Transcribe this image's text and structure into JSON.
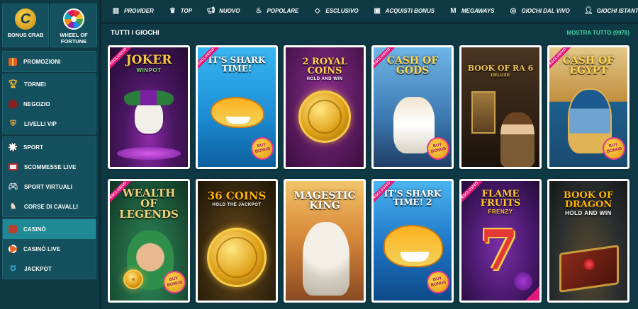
{
  "sidebar": {
    "tiles": [
      {
        "label": "Bonus Crab",
        "icon": "crab-coin-icon"
      },
      {
        "label": "Wheel of Fortune",
        "icon": "fortune-wheel-icon"
      }
    ],
    "group1": [
      {
        "label": "Promozioni",
        "icon": "gift-icon"
      }
    ],
    "group2": [
      {
        "label": "Tornei",
        "icon": "trophy-icon"
      },
      {
        "label": "Negozio",
        "icon": "shopping-bag-icon"
      },
      {
        "label": "Livelli VIP",
        "icon": "vip-shield-icon"
      }
    ],
    "group3": [
      {
        "label": "Sport",
        "icon": "soccer-ball-icon"
      },
      {
        "label": "Scommesse Live",
        "icon": "live-monitor-icon"
      },
      {
        "label": "Sport Virtuali",
        "icon": "gamepad-icon"
      },
      {
        "label": "Corse di Cavalli",
        "icon": "horse-icon"
      }
    ],
    "group4": [
      {
        "label": "Casinò",
        "icon": "casino-chip-icon",
        "active": true
      },
      {
        "label": "Casinò Live",
        "icon": "live-chip-icon"
      },
      {
        "label": "Jackpot",
        "icon": "horseshoe-icon"
      }
    ]
  },
  "topnav": [
    {
      "label": "Provider",
      "icon": "book-icon"
    },
    {
      "label": "Top",
      "icon": "crown-icon"
    },
    {
      "label": "Nuovo",
      "icon": "megaphone-icon"
    },
    {
      "label": "Popolare",
      "icon": "flame-icon"
    },
    {
      "label": "Esclusivo",
      "icon": "diamond-icon"
    },
    {
      "label": "Acquisti Bonus",
      "icon": "gift-box-icon"
    },
    {
      "label": "Megaways",
      "icon": "megaways-m-icon"
    },
    {
      "label": "Giochi dal vivo",
      "icon": "roulette-icon"
    },
    {
      "label": "Giochi istantanei",
      "icon": "person-icon"
    }
  ],
  "main": {
    "section_title": "Tutti i giochi",
    "show_all": "Mostra tutto (9978)"
  },
  "games": [
    {
      "title": "JOKER",
      "subtitle": "WINPOT",
      "exclusive": true,
      "buy_bonus": false,
      "bg": "#3d1a52"
    },
    {
      "title": "IT'S SHARK TIME!",
      "subtitle": "",
      "exclusive": true,
      "buy_bonus": true,
      "bg": "#1e8fd6"
    },
    {
      "title": "2 ROYAL COINS",
      "subtitle": "HOLD AND WIN",
      "exclusive": false,
      "buy_bonus": false,
      "bg": "#6b1f6f"
    },
    {
      "title": "CASH OF GODS",
      "subtitle": "",
      "exclusive": true,
      "buy_bonus": true,
      "bg": "#3b78b0"
    },
    {
      "title": "BOOK OF RA 6",
      "subtitle": "DELUXE",
      "exclusive": false,
      "buy_bonus": false,
      "bg": "#2f2114"
    },
    {
      "title": "CASH OF EGYPT",
      "subtitle": "",
      "exclusive": true,
      "buy_bonus": true,
      "bg": "#1e5f8c"
    },
    {
      "title": "WEALTH OF LEGENDS",
      "subtitle": "",
      "exclusive": true,
      "buy_bonus": true,
      "bg": "#1f5e3e"
    },
    {
      "title": "36 COINS",
      "subtitle": "HOLD THE JACKPOT",
      "exclusive": false,
      "buy_bonus": false,
      "bg": "#3a2a10"
    },
    {
      "title": "MAGESTIC KING",
      "subtitle": "",
      "exclusive": false,
      "buy_bonus": false,
      "bg": "#b9642a"
    },
    {
      "title": "IT'S SHARK TIME! 2",
      "subtitle": "",
      "exclusive": true,
      "buy_bonus": true,
      "bg": "#1d73c4"
    },
    {
      "title": "FLAME FRUITS",
      "subtitle": "FRENZY",
      "exclusive": true,
      "buy_bonus": false,
      "bg": "#4a1a6e"
    },
    {
      "title": "BOOK OF DRAGON",
      "subtitle": "HOLD AND WIN",
      "exclusive": false,
      "buy_bonus": false,
      "bg": "#2c3030"
    }
  ],
  "labels": {
    "exclusive": "ESCLUSIVO",
    "buy_bonus": "BUY BONUS"
  }
}
